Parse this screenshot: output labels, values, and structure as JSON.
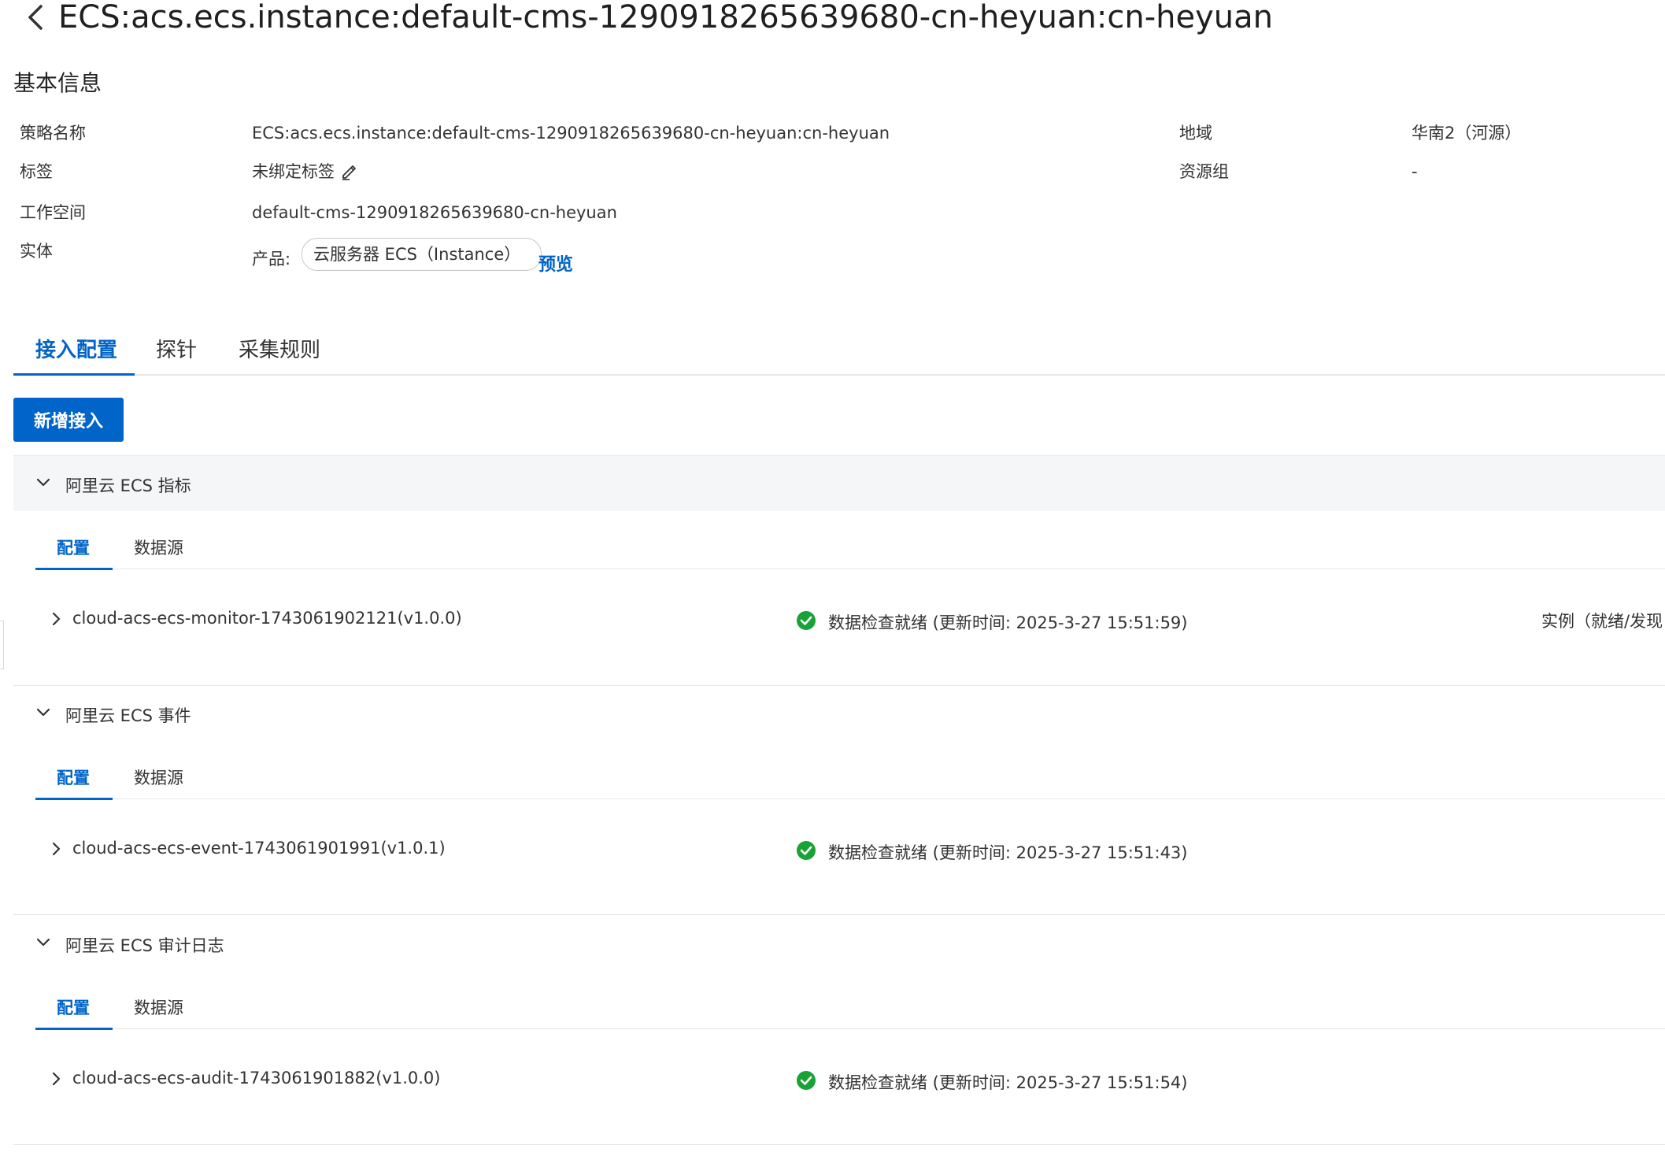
{
  "header": {
    "title": "ECS:acs.ecs.instance:default-cms-1290918265639680-cn-heyuan:cn-heyuan"
  },
  "basic_info": {
    "section_title": "基本信息",
    "policy_name_label": "策略名称",
    "policy_name_value": "ECS:acs.ecs.instance:default-cms-1290918265639680-cn-heyuan:cn-heyuan",
    "tags_label": "标签",
    "tags_value": "未绑定标签",
    "workspace_label": "工作空间",
    "workspace_value": "default-cms-1290918265639680-cn-heyuan",
    "entity_label": "实体",
    "product_prefix": "产品:",
    "product_value": "云服务器 ECS（Instance）",
    "preview_link": "预览",
    "region_label": "地域",
    "region_value": "华南2（河源）",
    "resource_group_label": "资源组",
    "resource_group_value": "-"
  },
  "tabs": [
    "接入配置",
    "探针",
    "采集规则"
  ],
  "add_button": "新增接入",
  "groups": [
    {
      "title": "阿里云 ECS 指标",
      "subtabs": [
        "配置",
        "数据源"
      ],
      "item": "cloud-acs-ecs-monitor-1743061902121(v1.0.0)",
      "status": "数据检查就绪 (更新时间: 2025-3-27 15:51:59)",
      "extra": "实例（就绪/发现"
    },
    {
      "title": "阿里云 ECS 事件",
      "subtabs": [
        "配置",
        "数据源"
      ],
      "item": "cloud-acs-ecs-event-1743061901991(v1.0.1)",
      "status": "数据检查就绪 (更新时间: 2025-3-27 15:51:43)"
    },
    {
      "title": "阿里云 ECS 审计日志",
      "subtabs": [
        "配置",
        "数据源"
      ],
      "item": "cloud-acs-ecs-audit-1743061901882(v1.0.0)",
      "status": "数据检查就绪 (更新时间: 2025-3-27 15:51:54)"
    }
  ],
  "colors": {
    "accent": "#0064c8",
    "success": "#18a336",
    "panel": "#f5f6f7"
  }
}
